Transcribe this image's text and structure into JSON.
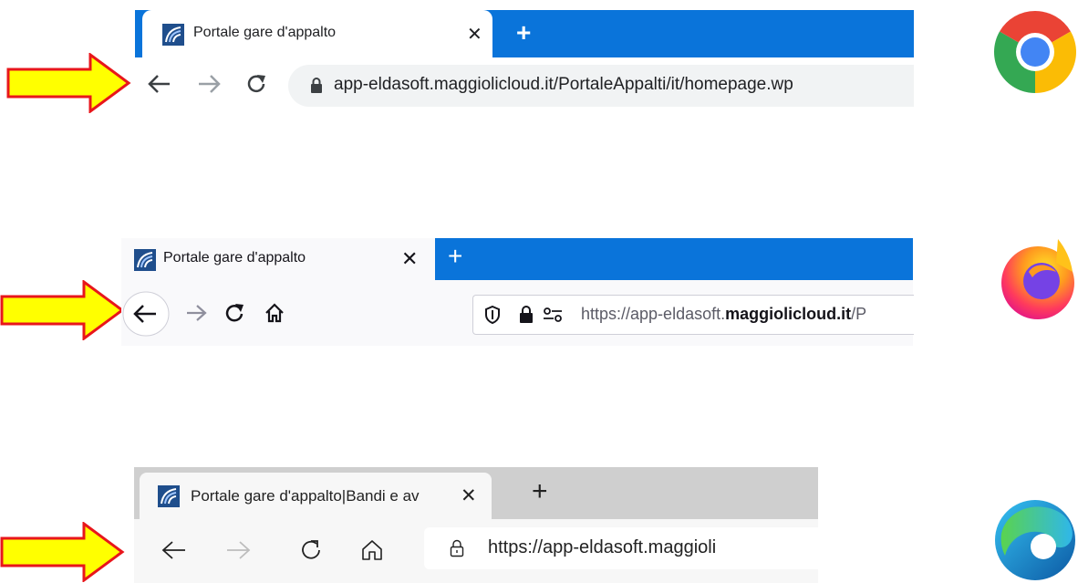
{
  "chrome": {
    "tab_title": "Portale gare d'appalto",
    "close_glyph": "✕",
    "newtab_glyph": "+",
    "url": "app-eldasoft.maggiolicloud.it/PortaleAppalti/it/homepage.wp",
    "icons": [
      "back-arrow-icon",
      "forward-arrow-icon",
      "reload-icon",
      "lock-icon",
      "chrome-logo-icon"
    ]
  },
  "firefox": {
    "tab_title": "Portale gare d'appalto",
    "close_glyph": "✕",
    "newtab_glyph": "+",
    "url_prefix": "https://app-eldasoft.",
    "url_domain": "maggiolicloud.it",
    "url_suffix": "/P",
    "icons": [
      "back-arrow-icon",
      "forward-arrow-icon",
      "reload-icon",
      "home-icon",
      "shield-icon",
      "lock-icon",
      "permissions-icon",
      "firefox-logo-icon"
    ]
  },
  "edge": {
    "tab_title": "Portale gare d'appalto|Bandi e av",
    "close_glyph": "✕",
    "newtab_glyph": "+",
    "url": "https://app-eldasoft.maggioli",
    "icons": [
      "back-arrow-icon",
      "forward-arrow-icon",
      "reload-icon",
      "home-icon",
      "lock-icon",
      "edge-logo-icon"
    ]
  },
  "colors": {
    "arrow_fill": "#ffff00",
    "arrow_stroke": "#e8161b",
    "chrome_tabbar": "#0a74da",
    "firefox_tabbar": "#0a74da",
    "edge_tabbar": "#cfcfcf"
  }
}
